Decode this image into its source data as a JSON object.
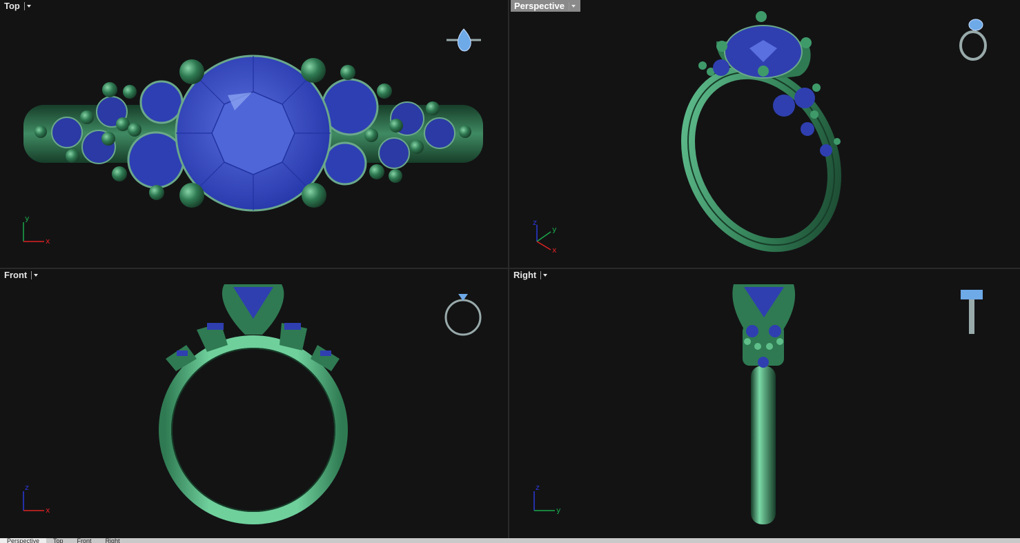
{
  "viewports": {
    "top": {
      "label": "Top"
    },
    "perspective": {
      "label": "Perspective"
    },
    "front": {
      "label": "Front"
    },
    "right": {
      "label": "Right"
    }
  },
  "axes": {
    "top": {
      "a": "y",
      "b": "x"
    },
    "perspective": {
      "a": "z",
      "b": "y",
      "c": "x"
    },
    "front": {
      "a": "z",
      "b": "x"
    },
    "right": {
      "a": "z",
      "b": "y"
    }
  },
  "tabs": [
    {
      "label": "Perspective",
      "active": true
    },
    {
      "label": "Top",
      "active": false
    },
    {
      "label": "Front",
      "active": false
    },
    {
      "label": "Right",
      "active": false
    }
  ],
  "icons": {
    "chevron": "chevron-down-icon",
    "axis": "axis-gizmo-icon",
    "thumbnail": "ring-thumbnail-icon"
  },
  "colors": {
    "metal": "#2f7a52",
    "metal_light": "#5fbf8a",
    "gem": "#2f3fb0",
    "gem_light": "#6e86e6",
    "background": "#131314"
  }
}
